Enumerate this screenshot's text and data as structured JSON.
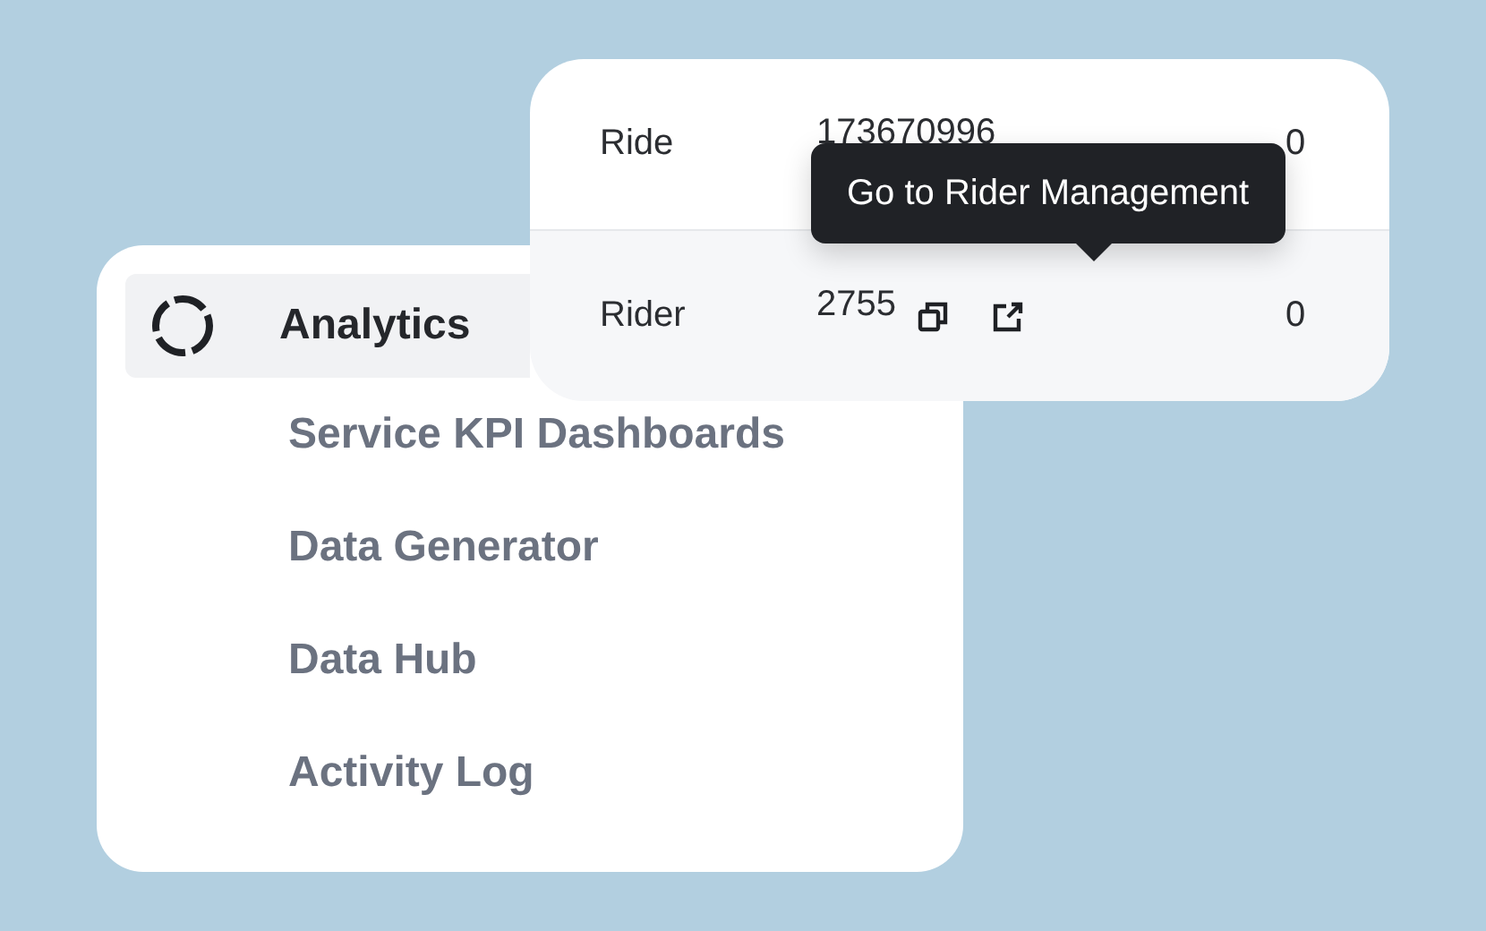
{
  "menu": {
    "section": {
      "label": "Analytics",
      "selected": true
    },
    "items": [
      {
        "label": "Service KPI Dashboards",
        "selected": false
      },
      {
        "label": "Data Generator",
        "selected": false
      },
      {
        "label": "Data Hub",
        "selected": false
      },
      {
        "label": "Activity Log",
        "selected": false
      }
    ]
  },
  "table": {
    "rows": [
      {
        "cells": [
          "Ride",
          "173670996",
          "0"
        ],
        "selected": false,
        "has_actions": false
      },
      {
        "cells": [
          "Rider",
          "2755",
          "0"
        ],
        "selected": true,
        "has_actions": true
      }
    ]
  },
  "tooltip": {
    "text": "Go to Rider Management"
  }
}
